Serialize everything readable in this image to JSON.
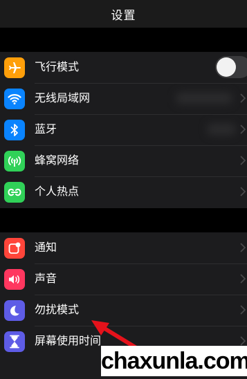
{
  "header": {
    "title": "设置"
  },
  "group1": {
    "items": [
      {
        "label": "飞行模式",
        "icon": "airplane-icon",
        "color": "#ff9f0a"
      },
      {
        "label": "无线局域网",
        "icon": "wifi-icon",
        "color": "#0a84ff"
      },
      {
        "label": "蓝牙",
        "icon": "bluetooth-icon",
        "color": "#0a84ff"
      },
      {
        "label": "蜂窝网络",
        "icon": "cellular-icon",
        "color": "#30d158"
      },
      {
        "label": "个人热点",
        "icon": "hotspot-icon",
        "color": "#30d158"
      }
    ],
    "airplane_mode_on": false
  },
  "group2": {
    "items": [
      {
        "label": "通知",
        "icon": "notifications-icon",
        "color": "#ff453a"
      },
      {
        "label": "声音",
        "icon": "sound-icon",
        "color": "#ff375f"
      },
      {
        "label": "勿扰模式",
        "icon": "moon-icon",
        "color": "#5e5ce6"
      },
      {
        "label": "屏幕使用时间",
        "icon": "hourglass-icon",
        "color": "#5e5ce6"
      }
    ]
  },
  "watermark": {
    "text": "chaxunla.com"
  },
  "annotation": {
    "arrow_color": "#e5121b"
  }
}
